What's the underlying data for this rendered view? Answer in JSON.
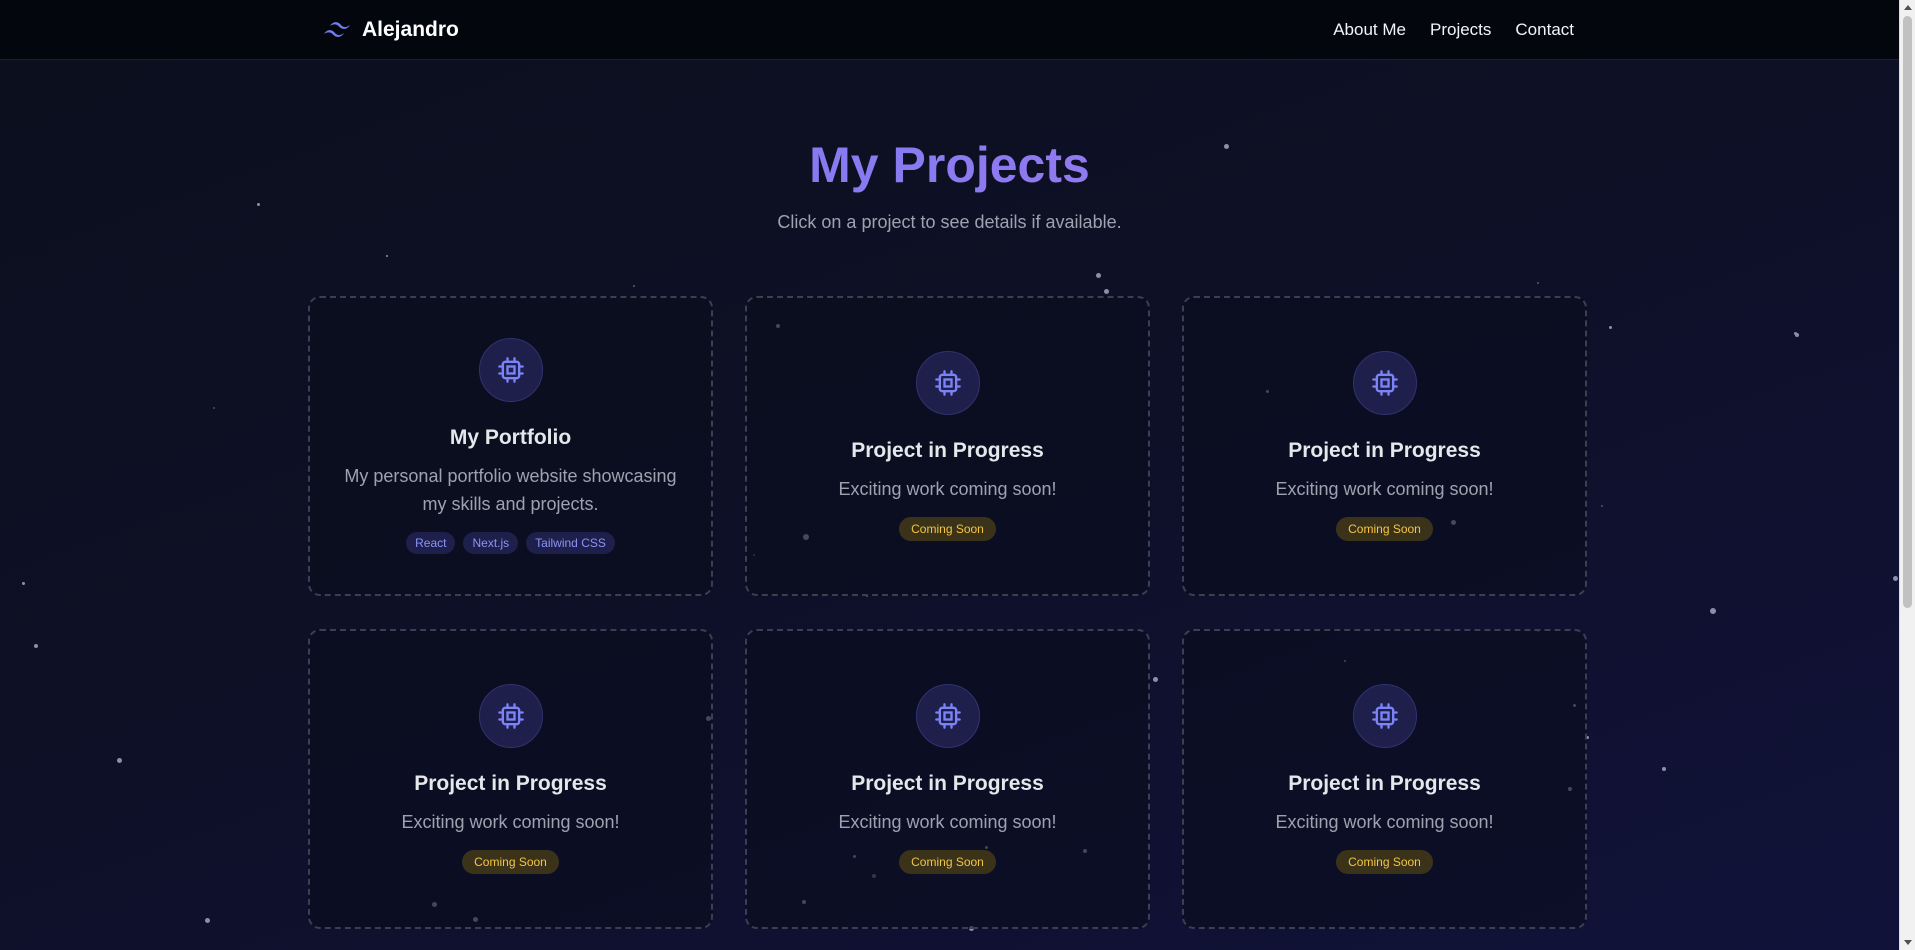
{
  "nav": {
    "brand": "Alejandro",
    "links": [
      {
        "label": "About Me"
      },
      {
        "label": "Projects"
      },
      {
        "label": "Contact"
      }
    ]
  },
  "hero": {
    "title": "My Projects",
    "subtitle": "Click on a project to see details if available."
  },
  "projects": [
    {
      "title": "My Portfolio",
      "description": "My personal portfolio website showcasing my skills and projects.",
      "tags": [
        "React",
        "Next.js",
        "Tailwind CSS"
      ],
      "icon": "chip-icon"
    },
    {
      "title": "Project in Progress",
      "description": "Exciting work coming soon!",
      "badge": "Coming Soon",
      "icon": "chip-icon"
    },
    {
      "title": "Project in Progress",
      "description": "Exciting work coming soon!",
      "badge": "Coming Soon",
      "icon": "chip-icon"
    },
    {
      "title": "Project in Progress",
      "description": "Exciting work coming soon!",
      "badge": "Coming Soon",
      "icon": "chip-icon"
    },
    {
      "title": "Project in Progress",
      "description": "Exciting work coming soon!",
      "badge": "Coming Soon",
      "icon": "chip-icon"
    },
    {
      "title": "Project in Progress",
      "description": "Exciting work coming soon!",
      "badge": "Coming Soon",
      "icon": "chip-icon"
    }
  ],
  "colors": {
    "accent": "#6f7cf4",
    "badge_text": "#f5c542",
    "tag_text": "#8a94f5",
    "background": "#0e1026"
  }
}
